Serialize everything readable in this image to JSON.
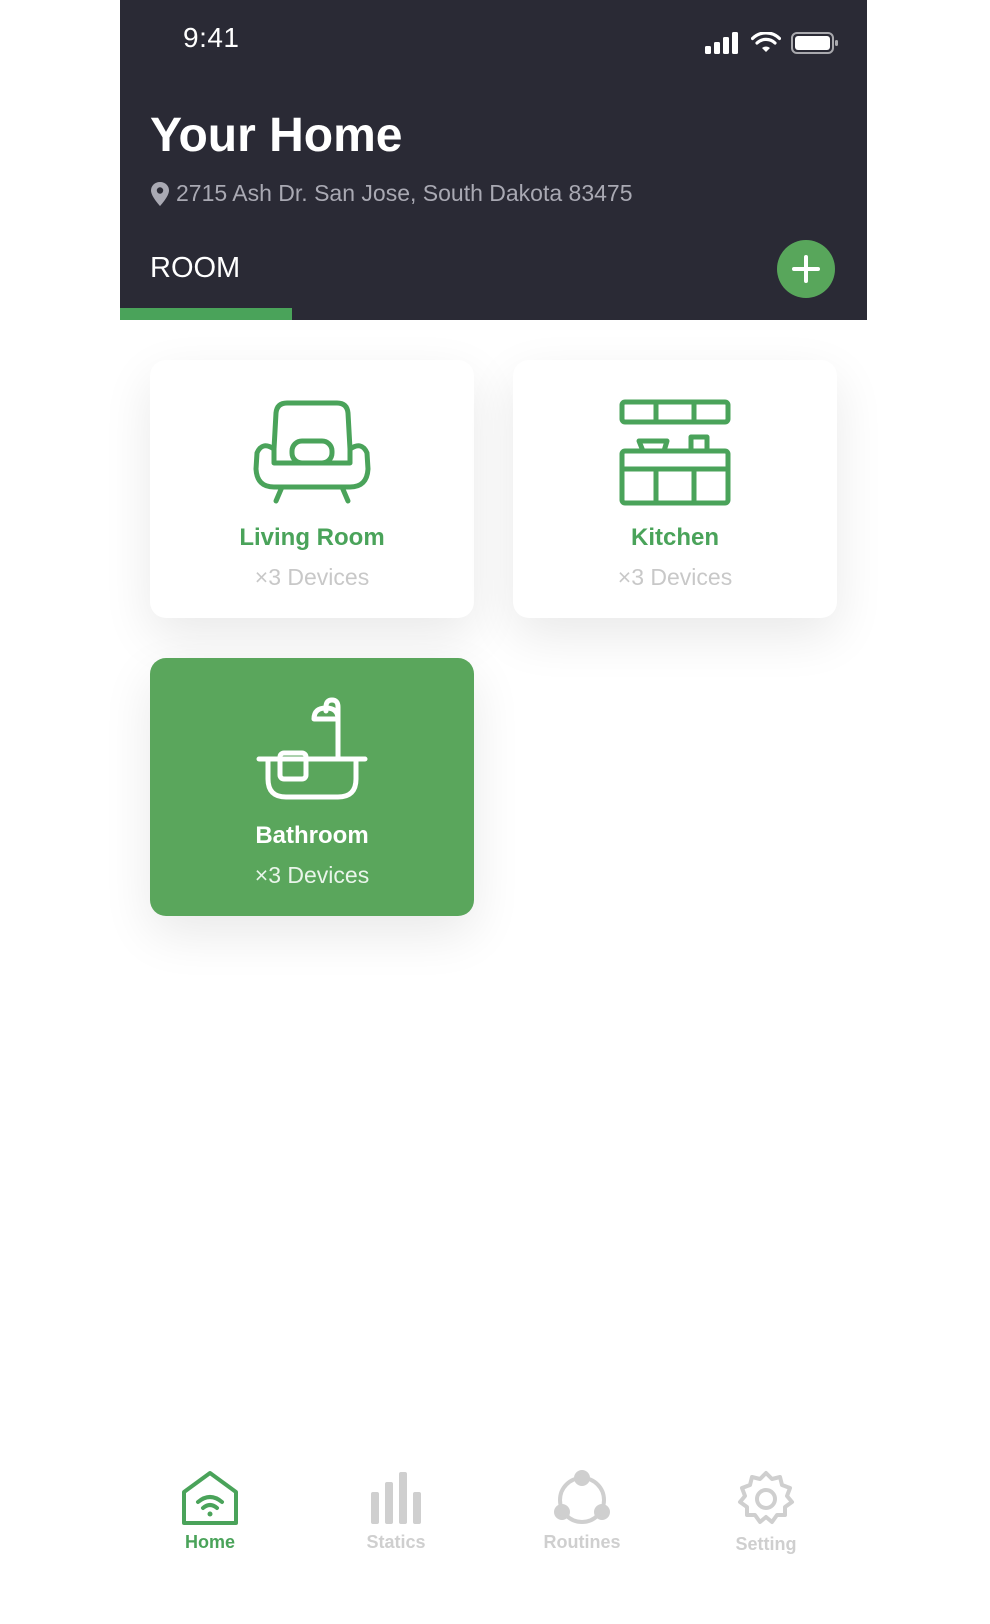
{
  "status_bar": {
    "time": "9:41"
  },
  "header": {
    "title": "Your Home",
    "address": "2715 Ash Dr. San Jose, South Dakota 83475",
    "tab_label": "ROOM"
  },
  "rooms": [
    {
      "name": "Living Room",
      "devices": "×3 Devices",
      "icon": "armchair-icon",
      "active": false
    },
    {
      "name": "Kitchen",
      "devices": "×3 Devices",
      "icon": "kitchen-icon",
      "active": false
    },
    {
      "name": "Bathroom",
      "devices": "×3 Devices",
      "icon": "bathtub-icon",
      "active": true
    }
  ],
  "nav": [
    {
      "label": "Home",
      "icon": "home-icon",
      "active": true
    },
    {
      "label": "Statics",
      "icon": "bar-chart-icon",
      "active": false
    },
    {
      "label": "Routines",
      "icon": "routines-icon",
      "active": false
    },
    {
      "label": "Setting",
      "icon": "gear-icon",
      "active": false
    }
  ],
  "colors": {
    "accent": "#4aa35a",
    "header_bg": "#2a2a35",
    "inactive": "#cfcfcf"
  }
}
